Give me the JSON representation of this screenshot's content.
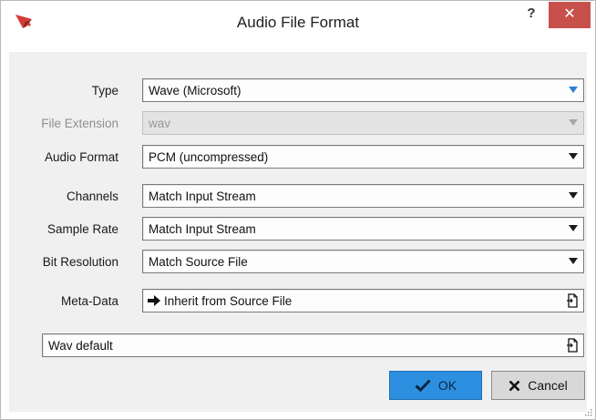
{
  "window": {
    "title": "Audio File Format",
    "help_label": "?",
    "close_label": "✕"
  },
  "form": {
    "type": {
      "label": "Type",
      "value": "Wave (Microsoft)"
    },
    "file_extension": {
      "label": "File Extension",
      "value": "wav"
    },
    "audio_format": {
      "label": "Audio Format",
      "value": "PCM (uncompressed)"
    },
    "channels": {
      "label": "Channels",
      "value": "Match Input Stream"
    },
    "sample_rate": {
      "label": "Sample Rate",
      "value": "Match Input Stream"
    },
    "bit_resolution": {
      "label": "Bit Resolution",
      "value": "Match Source File"
    },
    "meta_data": {
      "label": "Meta-Data",
      "value": "Inherit from Source File"
    }
  },
  "preset": {
    "value": "Wav default"
  },
  "buttons": {
    "ok_label": "OK",
    "cancel_label": "Cancel"
  },
  "colors": {
    "ok_button": "#2d8fe0",
    "close_button": "#c7504b",
    "dropdown_accent": "#2c7fd0"
  }
}
